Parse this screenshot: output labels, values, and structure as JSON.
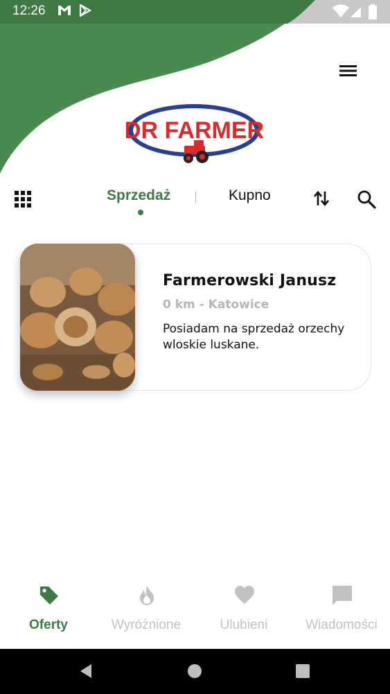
{
  "status_bar": {
    "time": "12:26",
    "icons": [
      "gmail-icon",
      "play-store-icon",
      "wifi-icon",
      "signal-icon",
      "battery-icon"
    ]
  },
  "header": {
    "menu_icon": "hamburger-menu-icon",
    "logo_text": "DR FARMER",
    "logo_icon": "tractor-icon"
  },
  "toolbar": {
    "grid_icon": "grid-icon",
    "tabs": [
      {
        "label": "Sprzedaż",
        "active": true
      },
      {
        "label": "Kupno",
        "active": false
      }
    ],
    "sort_icon": "sort-arrows-icon",
    "search_icon": "search-icon"
  },
  "offers": [
    {
      "title": "Farmerowski Janusz",
      "location": "0 km - Katowice",
      "description": "Posiadam na sprzedaż orzechy wloskie luskane.",
      "image": "walnuts-photo"
    }
  ],
  "bottom_nav": [
    {
      "label": "Oferty",
      "icon": "tag-icon",
      "active": true
    },
    {
      "label": "Wyróżnione",
      "icon": "flame-icon",
      "active": false
    },
    {
      "label": "Ulubieni",
      "icon": "heart-icon",
      "active": false
    },
    {
      "label": "Wiadomości",
      "icon": "chat-icon",
      "active": false
    }
  ],
  "colors": {
    "brand_green": "#3f7a45",
    "header_green": "#4b8a4f",
    "logo_red": "#d82b2b",
    "logo_blue": "#2a3f8f",
    "inactive_gray": "#c2c2c2"
  }
}
